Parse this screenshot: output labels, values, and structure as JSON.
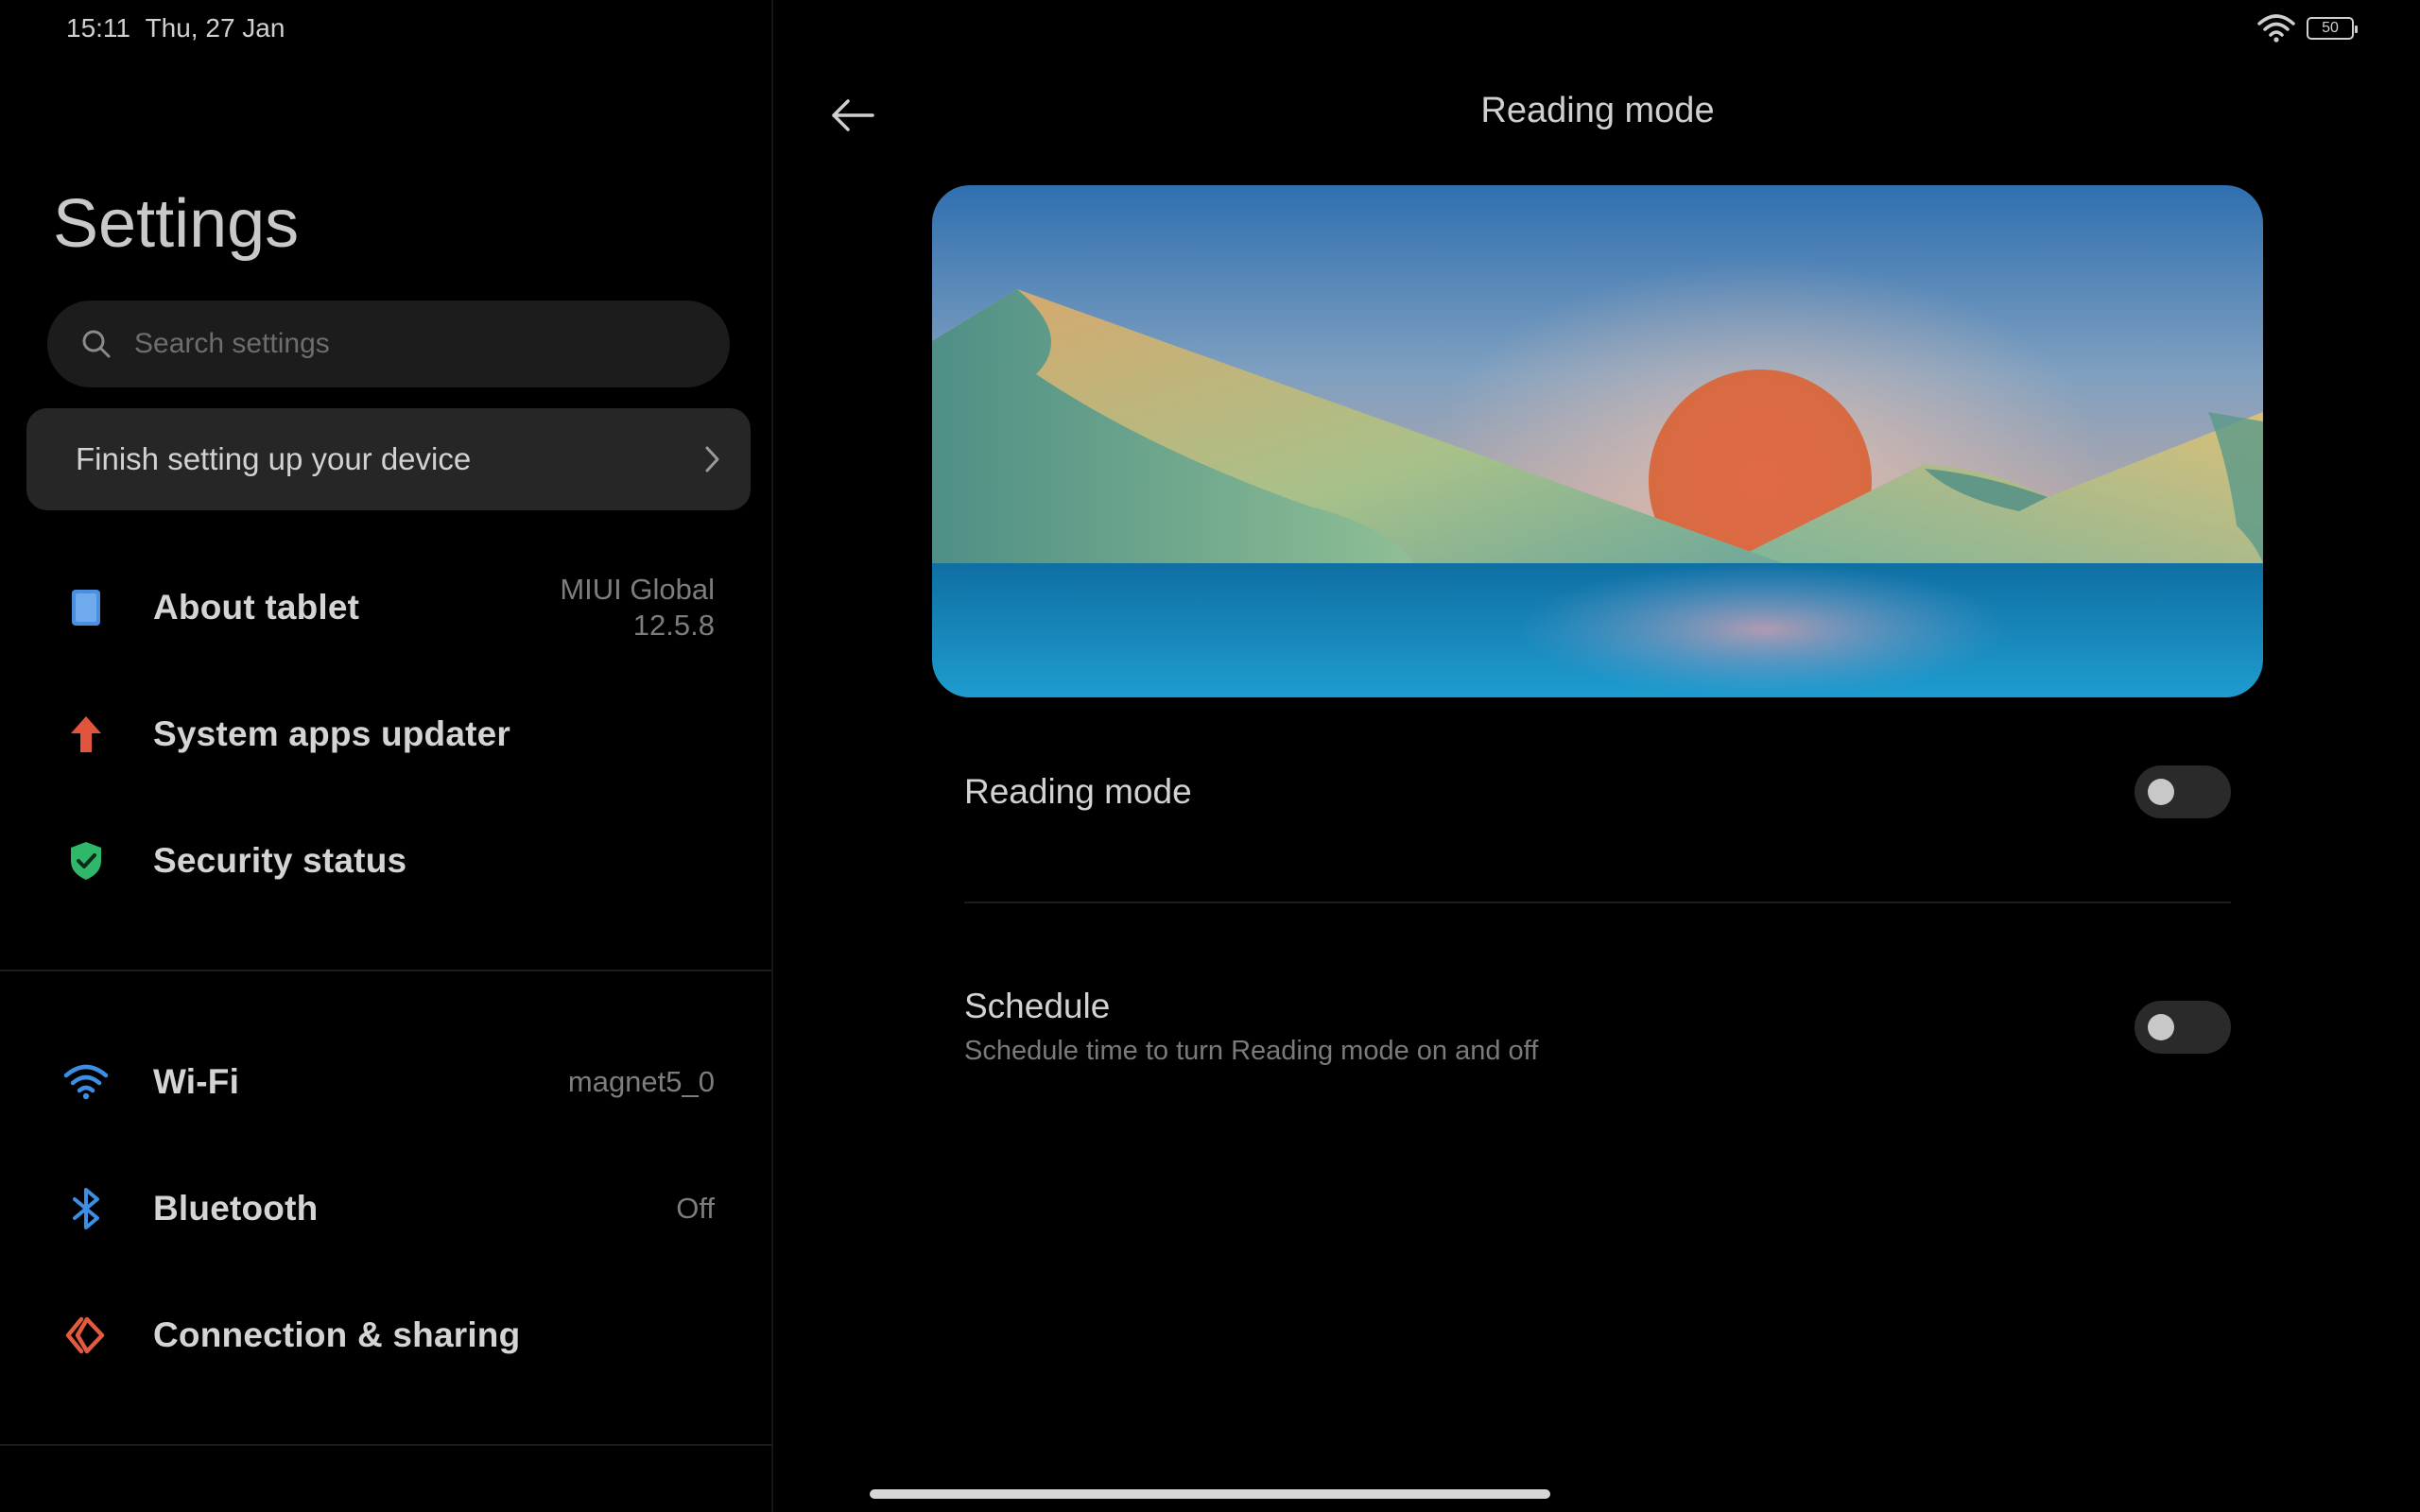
{
  "status_bar": {
    "time": "15:11",
    "date": "Thu, 27 Jan",
    "battery": "50",
    "icons": [
      "wifi-icon",
      "battery-icon"
    ]
  },
  "sidebar": {
    "title": "Settings",
    "search": {
      "placeholder": "Search settings",
      "value": ""
    },
    "finish_card": {
      "label": "Finish setting up your device"
    },
    "items": [
      {
        "label": "About tablet",
        "value_line1": "MIUI Global",
        "value_line2": "12.5.8",
        "icon": "tablet-icon",
        "icon_color": "#4a8fe0"
      },
      {
        "label": "System apps updater",
        "value_line1": "",
        "value_line2": "",
        "icon": "arrow-up-icon",
        "icon_color": "#e0553c"
      },
      {
        "label": "Security status",
        "value_line1": "",
        "value_line2": "",
        "icon": "shield-check-icon",
        "icon_color": "#2fb86a"
      },
      {
        "label": "Wi-Fi",
        "value_line1": "magnet5_0",
        "value_line2": "",
        "icon": "wifi-icon",
        "icon_color": "#3d8fe6"
      },
      {
        "label": "Bluetooth",
        "value_line1": "Off",
        "value_line2": "",
        "icon": "bluetooth-icon",
        "icon_color": "#3d8fe6"
      },
      {
        "label": "Connection & sharing",
        "value_line1": "",
        "value_line2": "",
        "icon": "connection-sharing-icon",
        "icon_color": "#e45a3f"
      }
    ]
  },
  "main": {
    "title": "Reading mode",
    "settings": [
      {
        "title": "Reading mode",
        "subtitle": "",
        "enabled": false
      },
      {
        "title": "Schedule",
        "subtitle": "Schedule time to turn Reading mode on and off",
        "enabled": false
      }
    ]
  },
  "colors": {
    "background": "#000000",
    "card": "#262626",
    "search": "#1c1c1c",
    "toggle_off": "#2a2a2a"
  }
}
